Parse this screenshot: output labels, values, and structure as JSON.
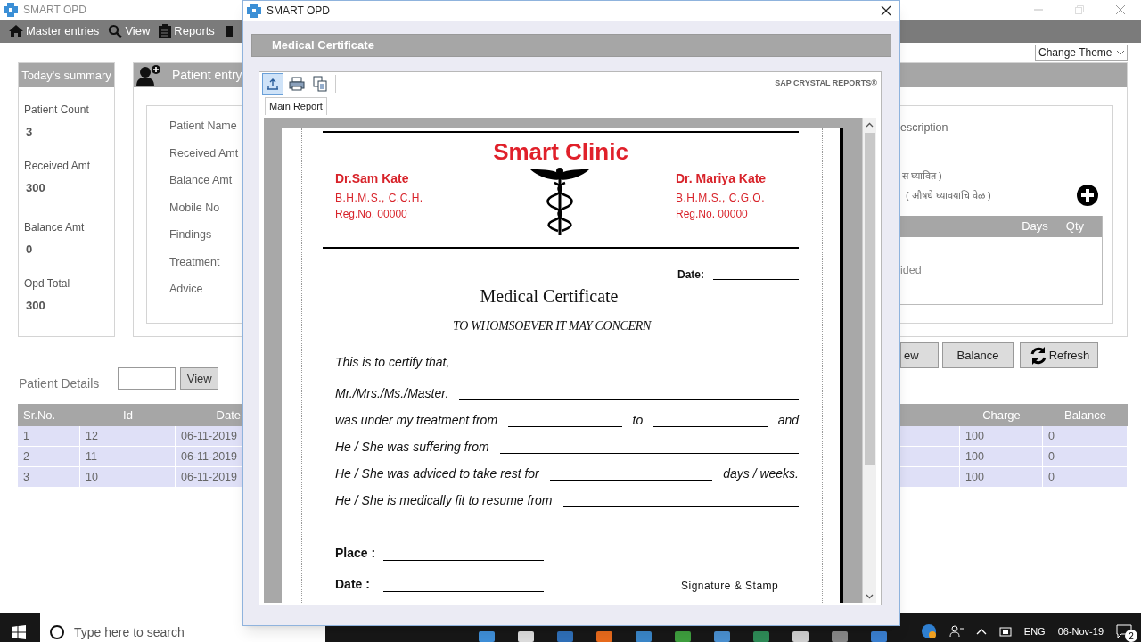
{
  "main_window": {
    "title": "SMART OPD"
  },
  "menu": [
    "Master entries",
    "View",
    "Reports"
  ],
  "theme_dropdown": {
    "value": "Change Theme"
  },
  "summary": {
    "title": "Today's summary",
    "items": [
      {
        "label": "Patient Count",
        "value": "3"
      },
      {
        "label": "Received Amt",
        "value": "300"
      },
      {
        "label": "Balance Amt",
        "value": "0"
      },
      {
        "label": "Opd Total",
        "value": "300"
      }
    ]
  },
  "patient_entry": {
    "title": "Patient entry",
    "fields": [
      "Patient Name",
      "Received Amt",
      "Balance Amt",
      "Mobile No",
      "Findings",
      "Treatment",
      "Advice"
    ],
    "prescription_label": "escription",
    "notes": [
      "स घ्यावित )",
      "( औषधे घ्यावयाचि वेळ )"
    ],
    "medicine_table": {
      "columns": [
        "Days",
        "Qty"
      ],
      "empty_text": "ided"
    }
  },
  "action_buttons": [
    "ew",
    "Balance",
    "Refresh"
  ],
  "patient_details": {
    "title": "Patient Details",
    "search_button": "View",
    "columns_left": [
      "Sr.No.",
      "Id",
      "Date"
    ],
    "columns_right": [
      "Charge",
      "Balance"
    ],
    "rows": [
      {
        "sr_no": "1",
        "id": "12",
        "date": "06-11-2019",
        "charge": "100",
        "balance": "0"
      },
      {
        "sr_no": "2",
        "id": "11",
        "date": "06-11-2019",
        "charge": "100",
        "balance": "0"
      },
      {
        "sr_no": "3",
        "id": "10",
        "date": "06-11-2019",
        "charge": "100",
        "balance": "0"
      }
    ]
  },
  "dialog": {
    "title": "SMART OPD",
    "heading": "Medical Certificate",
    "viewer": {
      "brand": "SAP CRYSTAL REPORTS®",
      "tabs": [
        {
          "label": "Main Report",
          "selected": true
        }
      ]
    },
    "certificate": {
      "clinic": "Smart Clinic",
      "doctors": [
        {
          "name": "Dr.Sam Kate",
          "degree": "B.H.M.S., C.C.H.",
          "reg": "Reg.No. 00000"
        },
        {
          "name": "Dr. Mariya Kate",
          "degree": "B.H.M.S., C.G.O.",
          "reg": "Reg.No. 00000"
        }
      ],
      "date_label": "Date:",
      "title": "Medical Certificate",
      "subtitle": "TO WHOMSOEVER IT MAY CONCERN",
      "intro": "This is to certify that,",
      "lines": [
        [
          {
            "kind": "text",
            "text": "Mr./Mrs./Ms./Master."
          },
          {
            "kind": "blank"
          }
        ],
        [
          {
            "kind": "text",
            "text": "was under my treatment from"
          },
          {
            "kind": "blank"
          },
          {
            "kind": "text",
            "text": "to"
          },
          {
            "kind": "blank"
          },
          {
            "kind": "text",
            "text": "and"
          }
        ],
        [
          {
            "kind": "text",
            "text": "He / She was suffering from"
          },
          {
            "kind": "blank"
          }
        ],
        [
          {
            "kind": "text",
            "text": "He / She was adviced to take rest for"
          },
          {
            "kind": "blank"
          },
          {
            "kind": "text",
            "text": "days / weeks."
          }
        ],
        [
          {
            "kind": "text",
            "text": "He / She is medically fit to resume from"
          },
          {
            "kind": "blank"
          }
        ]
      ],
      "place_label": "Place :",
      "bottom_date_label": "Date :",
      "signature": "Signature & Stamp"
    }
  },
  "taskbar": {
    "search_placeholder": "Type here to search",
    "language": "ENG",
    "date": "06-Nov-19",
    "notifications": "2"
  }
}
